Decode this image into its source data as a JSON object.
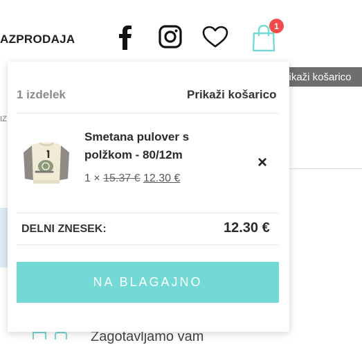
{
  "header": {
    "nav_label": "AZPRODAJA",
    "cart_badge_count": "1",
    "cart_tooltip": "Prikaži košarico",
    "icons": [
      "facebook-icon",
      "instagram-icon",
      "heart-icon",
      "shopping-bag-icon"
    ],
    "accent_color": "#73d9d4",
    "badge_color": "#f34b4b"
  },
  "mini_cart": {
    "item_count": "1 izdelek",
    "view_cart_link": "Prikaži košarico",
    "items": [
      {
        "name": "Smetana pulover s polžkom - 80/12m",
        "quantity_prefix": "1 ×",
        "old_price": "15.37 €",
        "price": "12.30 €",
        "remove_label": "×"
      }
    ],
    "subtotal_label": "DELNI ZNESEK:",
    "subtotal_value": "12.30 €",
    "checkout_label": "NA BLAGAJNO"
  },
  "background": {
    "edge_text": "IZ",
    "bottom_text": "Zagotavljamo vam"
  }
}
